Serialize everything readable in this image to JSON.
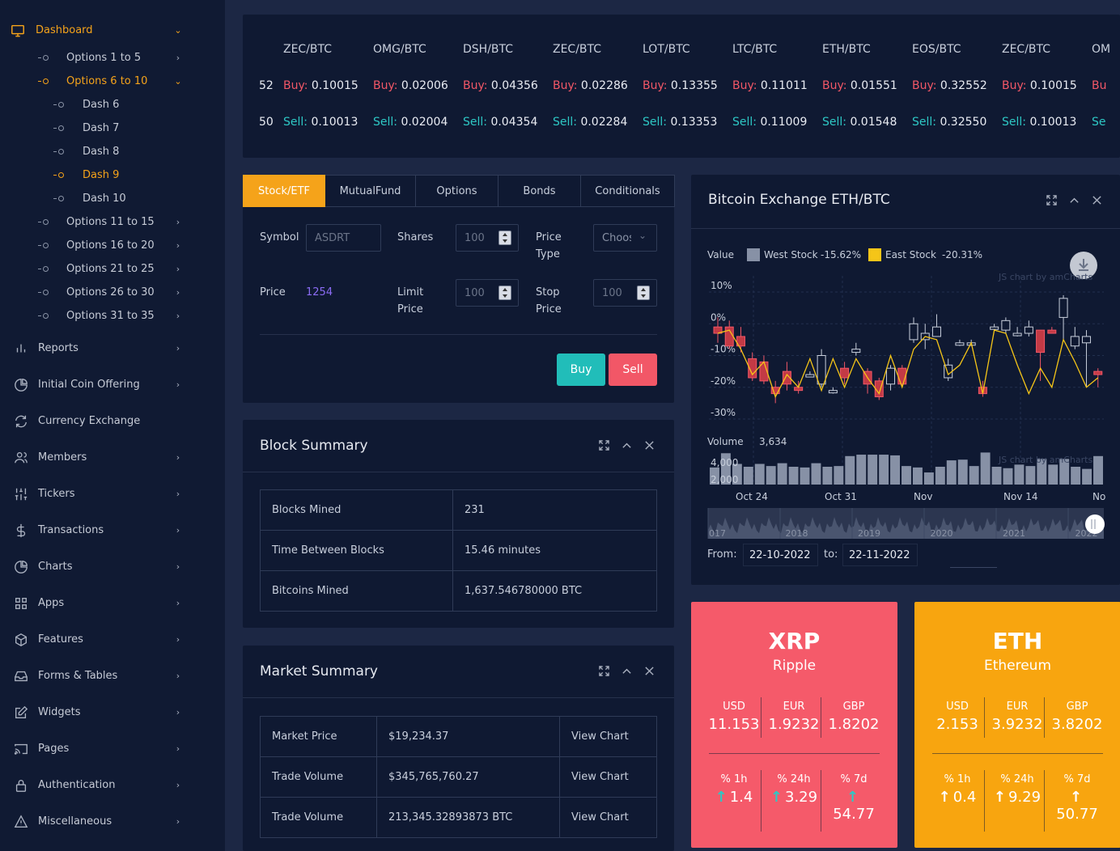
{
  "sidebar": {
    "dashboard": "Dashboard",
    "options": [
      {
        "label": "Options 1 to 5"
      },
      {
        "label": "Options 6 to 10"
      },
      {
        "label": "Options 11 to 15"
      },
      {
        "label": "Options 16 to 20"
      },
      {
        "label": "Options 21 to 25"
      },
      {
        "label": "Options 26 to 30"
      },
      {
        "label": "Options 31 to 35"
      }
    ],
    "dashes": [
      "Dash 6",
      "Dash 7",
      "Dash 8",
      "Dash 9",
      "Dash 10"
    ],
    "menu": [
      {
        "label": "Reports",
        "icon": "bar-chart-icon",
        "chevron": true
      },
      {
        "label": "Initial Coin Offering",
        "icon": "pie-chart-icon",
        "chevron": true
      },
      {
        "label": "Currency Exchange",
        "icon": "refresh-icon",
        "chevron": false
      },
      {
        "label": "Members",
        "icon": "users-icon",
        "chevron": true
      },
      {
        "label": "Tickers",
        "icon": "sliders-icon",
        "chevron": true
      },
      {
        "label": "Transactions",
        "icon": "dollar-icon",
        "chevron": true
      },
      {
        "label": "Charts",
        "icon": "pie-chart-icon",
        "chevron": true
      },
      {
        "label": "Apps",
        "icon": "grid-icon",
        "chevron": true
      },
      {
        "label": "Features",
        "icon": "box-icon",
        "chevron": true
      },
      {
        "label": "Forms & Tables",
        "icon": "inbox-icon",
        "chevron": true
      },
      {
        "label": "Widgets",
        "icon": "edit-icon",
        "chevron": true
      },
      {
        "label": "Pages",
        "icon": "cast-icon",
        "chevron": true
      },
      {
        "label": "Authentication",
        "icon": "lock-icon",
        "chevron": true
      },
      {
        "label": "Miscellaneous",
        "icon": "alert-icon",
        "chevron": true
      }
    ]
  },
  "ticker": {
    "partial_left": {
      "buy": "52",
      "sell": "50"
    },
    "items": [
      {
        "pair": "ZEC/BTC",
        "buy_label": "Buy:",
        "buy": "0.10015",
        "sell_label": "Sell:",
        "sell": "0.10013"
      },
      {
        "pair": "OMG/BTC",
        "buy_label": "Buy:",
        "buy": "0.02006",
        "sell_label": "Sell:",
        "sell": "0.02004"
      },
      {
        "pair": "DSH/BTC",
        "buy_label": "Buy:",
        "buy": "0.04356",
        "sell_label": "Sell:",
        "sell": "0.04354"
      },
      {
        "pair": "ZEC/BTC",
        "buy_label": "Buy:",
        "buy": "0.02286",
        "sell_label": "Sell:",
        "sell": "0.02284"
      },
      {
        "pair": "LOT/BTC",
        "buy_label": "Buy:",
        "buy": "0.13355",
        "sell_label": "Sell:",
        "sell": "0.13353"
      },
      {
        "pair": "LTC/BTC",
        "buy_label": "Buy:",
        "buy": "0.11011",
        "sell_label": "Sell:",
        "sell": "0.11009"
      },
      {
        "pair": "ETH/BTC",
        "buy_label": "Buy:",
        "buy": "0.01551",
        "sell_label": "Sell:",
        "sell": "0.01548"
      },
      {
        "pair": "EOS/BTC",
        "buy_label": "Buy:",
        "buy": "0.32552",
        "sell_label": "Sell:",
        "sell": "0.32550"
      },
      {
        "pair": "ZEC/BTC",
        "buy_label": "Buy:",
        "buy": "0.10015",
        "sell_label": "Sell:",
        "sell": "0.10013"
      },
      {
        "pair": "OM",
        "buy_label": "Bu",
        "buy": "",
        "sell_label": "Se",
        "sell": ""
      }
    ]
  },
  "order": {
    "tabs": [
      "Stock/ETF",
      "MutualFund",
      "Options",
      "Bonds",
      "Conditionals"
    ],
    "symbol_label": "Symbol",
    "symbol_placeholder": "ASDRT",
    "shares_label": "Shares",
    "shares_value": "100",
    "price_type_label": "Price Type",
    "price_type_value": "Choos",
    "price_label": "Price",
    "price_value": "1254",
    "limit_label": "Limit Price",
    "limit_value": "100",
    "stop_label": "Stop Price",
    "stop_value": "100",
    "buy": "Buy",
    "sell": "Sell"
  },
  "block_summary": {
    "title": "Block Summary",
    "rows": [
      {
        "label": "Blocks Mined",
        "value": "231"
      },
      {
        "label": "Time Between Blocks",
        "value": "15.46 minutes"
      },
      {
        "label": "Bitcoins Mined",
        "value": "1,637.546780000 BTC"
      }
    ]
  },
  "market_summary": {
    "title": "Market Summary",
    "rows": [
      {
        "label": "Market Price",
        "value": "$19,234.37",
        "link": "View Chart"
      },
      {
        "label": "Trade Volume",
        "value": "$345,765,760.27",
        "link": "View Chart"
      },
      {
        "label": "Trade Volume",
        "value": "213,345.32893873 BTC",
        "link": "View Chart"
      }
    ]
  },
  "exchange_chart": {
    "title": "Bitcoin Exchange ETH/BTC",
    "value_label": "Value",
    "legend": [
      {
        "name": "West Stock",
        "change": "-15.62%",
        "color": "#8791a6"
      },
      {
        "name": "East Stock",
        "change": "-20.31%",
        "color": "#f5c518"
      }
    ],
    "watermark": "JS chart by amCharts",
    "volume_label": "Volume",
    "volume_value": "3,634",
    "from_label": "From:",
    "from_value": "22-10-2022",
    "to_label": "to:",
    "to_value": "22-11-2022",
    "years": [
      "017",
      "2018",
      "2019",
      "2020",
      "2021",
      "2022"
    ]
  },
  "chart_data": {
    "type": "candlestick",
    "title": "Bitcoin Exchange ETH/BTC",
    "y_ticks": [
      "10%",
      "0%",
      "-10%",
      "-20%",
      "-30%"
    ],
    "ylim": [
      -30,
      10
    ],
    "volume_ticks": [
      "4,000",
      "2,000"
    ],
    "volume_ylim": [
      0,
      5000
    ],
    "x_ticks": [
      "Oct 24",
      "Oct 31",
      "Nov",
      "Nov 14",
      "No"
    ],
    "candles": [
      [
        -1,
        -3,
        2,
        -6
      ],
      [
        -1,
        -7,
        1,
        -8
      ],
      [
        -4,
        -7,
        -1,
        -9
      ],
      [
        -11,
        -17,
        -9,
        -18
      ],
      [
        -12,
        -18,
        -10,
        -19
      ],
      [
        -20,
        -22,
        -18,
        -25
      ],
      [
        -15,
        -19,
        -12,
        -21
      ],
      [
        -20,
        -21,
        -18,
        -22
      ],
      [
        -16,
        -16,
        -15,
        -16
      ],
      [
        -19,
        -10,
        -8,
        -20
      ],
      [
        -21,
        -21,
        -20,
        -22
      ],
      [
        -14,
        -17,
        -12,
        -19
      ],
      [
        -9,
        -8,
        -6,
        -10
      ],
      [
        -15,
        -19,
        -14,
        -22
      ],
      [
        -18,
        -23,
        -17,
        -24
      ],
      [
        -19,
        -14,
        -13,
        -21
      ],
      [
        -14,
        -19,
        -13,
        -20
      ],
      [
        -5,
        0,
        2,
        -6
      ],
      [
        -5,
        -3,
        0,
        -8
      ],
      [
        -4,
        -1,
        3,
        -4
      ],
      [
        -17,
        -13,
        -11,
        -18
      ],
      [
        -6,
        -6,
        -5,
        -7
      ],
      [
        -6,
        -6,
        -5,
        -7
      ],
      [
        -20,
        -22,
        -18,
        -23
      ],
      [
        -1,
        -1,
        0,
        -2
      ],
      [
        -2,
        1,
        2,
        -3
      ],
      [
        -3,
        -3,
        -1,
        -4
      ],
      [
        -3,
        -1,
        1,
        -4
      ],
      [
        -2,
        -9,
        -7,
        -18
      ],
      [
        -2,
        -3,
        -1,
        -3
      ],
      [
        2,
        8,
        9,
        -5
      ],
      [
        -7,
        -4,
        -1,
        -8
      ],
      [
        -6,
        -4,
        -2,
        -20
      ],
      [
        -15,
        -16,
        -14,
        -20
      ]
    ],
    "line": [
      -3,
      -2,
      -8,
      -16,
      -12,
      -23,
      -16,
      -20,
      -11,
      -21,
      -11,
      -20,
      -11,
      -17,
      -22,
      -10,
      -20,
      -8,
      -4,
      -5,
      -16,
      -13,
      -6,
      -22,
      -2,
      -3,
      -13,
      -22,
      -14,
      -20,
      -5,
      -12,
      -20,
      -17
    ],
    "volume": [
      2400,
      4400,
      2900,
      2500,
      2900,
      2600,
      3000,
      2500,
      2400,
      3000,
      2500,
      2600,
      4000,
      4200,
      4200,
      4200,
      4100,
      2600,
      2400,
      1700,
      2500,
      3400,
      3500,
      2600,
      4500,
      2500,
      2300,
      2800,
      2600,
      3600,
      2800,
      3600,
      2500,
      2200,
      4000
    ]
  },
  "coins": [
    {
      "symbol": "XRP",
      "name": "Ripple",
      "bg": "#f55a6a",
      "arrow_color": "#2ec8c5",
      "prices": [
        {
          "label": "USD",
          "value": "11.153"
        },
        {
          "label": "EUR",
          "value": "1.9232"
        },
        {
          "label": "GBP",
          "value": "1.8202"
        }
      ],
      "changes": [
        {
          "label": "% 1h",
          "value": "1.4"
        },
        {
          "label": "% 24h",
          "value": "3.29"
        },
        {
          "label": "% 7d",
          "value": "54.77"
        }
      ]
    },
    {
      "symbol": "ETH",
      "name": "Ethereum",
      "bg": "#f8a50f",
      "arrow_color": "#ffffff",
      "prices": [
        {
          "label": "USD",
          "value": "2.153"
        },
        {
          "label": "EUR",
          "value": "3.9232"
        },
        {
          "label": "GBP",
          "value": "3.8202"
        }
      ],
      "changes": [
        {
          "label": "% 1h",
          "value": "0.4"
        },
        {
          "label": "% 24h",
          "value": "9.29"
        },
        {
          "label": "% 7d",
          "value": "50.77"
        }
      ]
    }
  ]
}
